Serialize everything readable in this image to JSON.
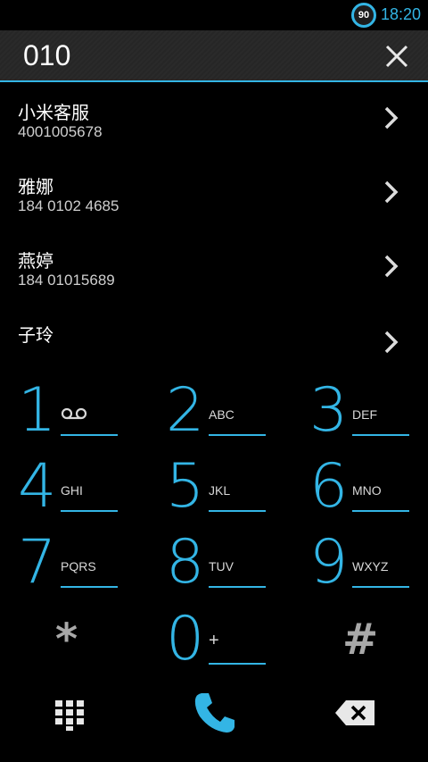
{
  "status": {
    "battery": "90",
    "time": "18:20"
  },
  "dialer": {
    "digits": "010"
  },
  "contacts": [
    {
      "name": "小米客服",
      "number": "4001005678"
    },
    {
      "name": "雅娜",
      "number": "184 0102 4685"
    },
    {
      "name": "燕婷",
      "number": "184 01015689"
    },
    {
      "name": "子玲",
      "number": ""
    }
  ],
  "keypad": [
    {
      "digit": "1",
      "letters": ""
    },
    {
      "digit": "2",
      "letters": "ABC"
    },
    {
      "digit": "3",
      "letters": "DEF"
    },
    {
      "digit": "4",
      "letters": "GHI"
    },
    {
      "digit": "5",
      "letters": "JKL"
    },
    {
      "digit": "6",
      "letters": "MNO"
    },
    {
      "digit": "7",
      "letters": "PQRS"
    },
    {
      "digit": "8",
      "letters": "TUV"
    },
    {
      "digit": "9",
      "letters": "WXYZ"
    },
    {
      "digit": "*",
      "letters": ""
    },
    {
      "digit": "0",
      "letters": "+"
    },
    {
      "digit": "#",
      "letters": ""
    }
  ],
  "icons": {
    "voicemail": "voicemail-icon",
    "clear": "close-icon",
    "chevron": "chevron-right-icon",
    "dialpad": "dialpad-icon",
    "call": "phone-icon",
    "backspace": "backspace-icon"
  },
  "colors": {
    "accent": "#33b5e5",
    "background": "#000000"
  }
}
